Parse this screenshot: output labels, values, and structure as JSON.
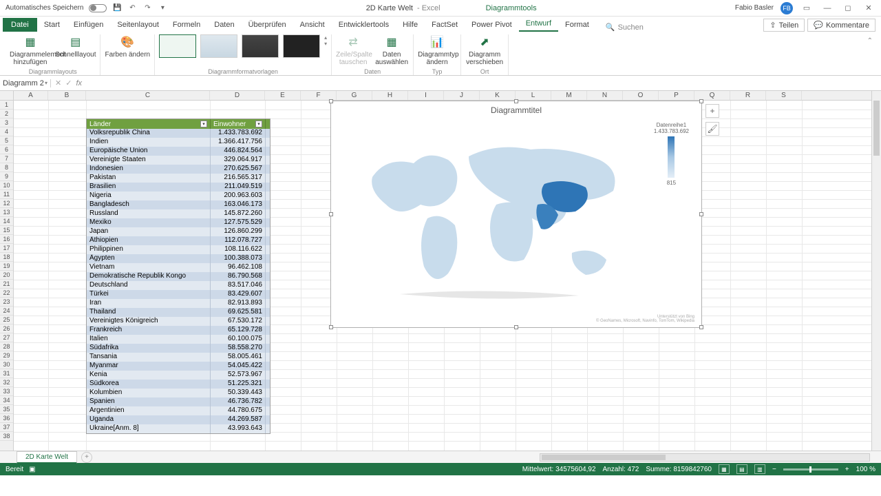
{
  "titlebar": {
    "autosave": "Automatisches Speichern",
    "filename": "2D Karte Welt",
    "app": "Excel",
    "context_tool": "Diagrammtools",
    "user": "Fabio Basler",
    "user_initials": "FB"
  },
  "tabs": {
    "file": "Datei",
    "items": [
      "Start",
      "Einfügen",
      "Seitenlayout",
      "Formeln",
      "Daten",
      "Überprüfen",
      "Ansicht",
      "Entwicklertools",
      "Hilfe",
      "FactSet",
      "Power Pivot",
      "Entwurf",
      "Format"
    ],
    "active": "Entwurf",
    "search": "Suchen",
    "share": "Teilen",
    "comments": "Kommentare"
  },
  "ribbon": {
    "group_layouts": "Diagrammlayouts",
    "btn_element": "Diagrammelement hinzufügen",
    "btn_quicklayout": "Schnelllayout",
    "btn_colors": "Farben ändern",
    "group_styles": "Diagrammformatvorlagen",
    "group_data": "Daten",
    "btn_switch": "Zeile/Spalte tauschen",
    "btn_select": "Daten auswählen",
    "group_type": "Typ",
    "btn_changetype": "Diagrammtyp ändern",
    "group_loc": "Ort",
    "btn_move": "Diagramm verschieben"
  },
  "namebox": "Diagramm 2",
  "columns": [
    "A",
    "B",
    "C",
    "D",
    "E",
    "F",
    "G",
    "H",
    "I",
    "J",
    "K",
    "L",
    "M",
    "N",
    "O",
    "P",
    "Q",
    "R",
    "S"
  ],
  "rows": 38,
  "table": {
    "header_c": "Länder",
    "header_d": "Einwohner",
    "rows": [
      [
        "Volksrepublik China",
        "1.433.783.692"
      ],
      [
        "Indien",
        "1.366.417.756"
      ],
      [
        "Europäische Union",
        "446.824.564"
      ],
      [
        "Vereinigte Staaten",
        "329.064.917"
      ],
      [
        "Indonesien",
        "270.625.567"
      ],
      [
        "Pakistan",
        "216.565.317"
      ],
      [
        "Brasilien",
        "211.049.519"
      ],
      [
        "Nigeria",
        "200.963.603"
      ],
      [
        "Bangladesch",
        "163.046.173"
      ],
      [
        "Russland",
        "145.872.260"
      ],
      [
        "Mexiko",
        "127.575.529"
      ],
      [
        "Japan",
        "126.860.299"
      ],
      [
        "Äthiopien",
        "112.078.727"
      ],
      [
        "Philippinen",
        "108.116.622"
      ],
      [
        "Ägypten",
        "100.388.073"
      ],
      [
        "Vietnam",
        "96.462.108"
      ],
      [
        "Demokratische Republik Kongo",
        "86.790.568"
      ],
      [
        "Deutschland",
        "83.517.046"
      ],
      [
        "Türkei",
        "83.429.607"
      ],
      [
        "Iran",
        "82.913.893"
      ],
      [
        "Thailand",
        "69.625.581"
      ],
      [
        "Vereinigtes Königreich",
        "67.530.172"
      ],
      [
        "Frankreich",
        "65.129.728"
      ],
      [
        "Italien",
        "60.100.075"
      ],
      [
        "Südafrika",
        "58.558.270"
      ],
      [
        "Tansania",
        "58.005.461"
      ],
      [
        "Myanmar",
        "54.045.422"
      ],
      [
        "Kenia",
        "52.573.967"
      ],
      [
        "Südkorea",
        "51.225.321"
      ],
      [
        "Kolumbien",
        "50.339.443"
      ],
      [
        "Spanien",
        "46.736.782"
      ],
      [
        "Argentinien",
        "44.780.675"
      ],
      [
        "Uganda",
        "44.269.587"
      ],
      [
        "Ukraine[Anm. 8]",
        "43.993.643"
      ]
    ]
  },
  "chart": {
    "title": "Diagrammtitel",
    "legend_title": "Datenreihe1",
    "legend_max": "1.433.783.692",
    "legend_min": "815",
    "credit1": "Unterstützt von Bing",
    "credit2": "© GeoNames, Microsoft, Navinfo, TomTom, Wikipedia"
  },
  "chart_data": {
    "type": "map",
    "title": "Diagrammtitel",
    "series_name": "Datenreihe1",
    "color_scale": {
      "min": 815,
      "max": 1433783692,
      "min_color": "#e4eef7",
      "max_color": "#2e75b6"
    },
    "data": [
      {
        "country": "Volksrepublik China",
        "value": 1433783692
      },
      {
        "country": "Indien",
        "value": 1366417756
      },
      {
        "country": "Europäische Union",
        "value": 446824564
      },
      {
        "country": "Vereinigte Staaten",
        "value": 329064917
      },
      {
        "country": "Indonesien",
        "value": 270625567
      },
      {
        "country": "Pakistan",
        "value": 216565317
      },
      {
        "country": "Brasilien",
        "value": 211049519
      },
      {
        "country": "Nigeria",
        "value": 200963603
      },
      {
        "country": "Bangladesch",
        "value": 163046173
      },
      {
        "country": "Russland",
        "value": 145872260
      },
      {
        "country": "Mexiko",
        "value": 127575529
      },
      {
        "country": "Japan",
        "value": 126860299
      },
      {
        "country": "Äthiopien",
        "value": 112078727
      },
      {
        "country": "Philippinen",
        "value": 108116622
      },
      {
        "country": "Ägypten",
        "value": 100388073
      },
      {
        "country": "Vietnam",
        "value": 96462108
      },
      {
        "country": "Demokratische Republik Kongo",
        "value": 86790568
      },
      {
        "country": "Deutschland",
        "value": 83517046
      },
      {
        "country": "Türkei",
        "value": 83429607
      },
      {
        "country": "Iran",
        "value": 82913893
      },
      {
        "country": "Thailand",
        "value": 69625581
      },
      {
        "country": "Vereinigtes Königreich",
        "value": 67530172
      },
      {
        "country": "Frankreich",
        "value": 65129728
      },
      {
        "country": "Italien",
        "value": 60100075
      },
      {
        "country": "Südafrika",
        "value": 58558270
      },
      {
        "country": "Tansania",
        "value": 58005461
      },
      {
        "country": "Myanmar",
        "value": 54045422
      },
      {
        "country": "Kenia",
        "value": 52573967
      },
      {
        "country": "Südkorea",
        "value": 51225321
      },
      {
        "country": "Kolumbien",
        "value": 50339443
      },
      {
        "country": "Spanien",
        "value": 46736782
      },
      {
        "country": "Argentinien",
        "value": 44780675
      },
      {
        "country": "Uganda",
        "value": 44269587
      },
      {
        "country": "Ukraine",
        "value": 43993643
      }
    ]
  },
  "sheet": {
    "name": "2D Karte Welt"
  },
  "status": {
    "ready": "Bereit",
    "avg": "Mittelwert: 34575604,92",
    "count": "Anzahl: 472",
    "sum": "Summe: 8159842760",
    "zoom": "100 %"
  }
}
